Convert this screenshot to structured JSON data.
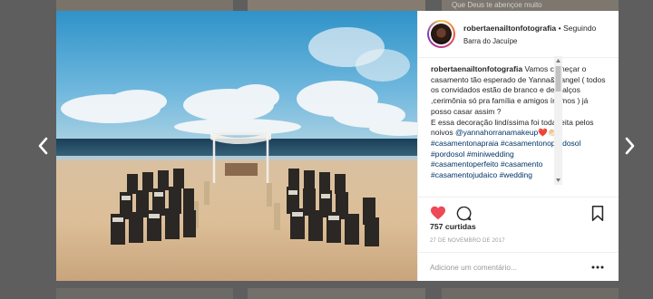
{
  "background": {
    "caption_text": "Que Deus te abençoe muito"
  },
  "post": {
    "username": "robertaenailtonfotografia",
    "separator": "•",
    "follow_status": "Seguindo",
    "location": "Barra do Jacuípe",
    "caption": {
      "user": "robertaenailtonfotografia",
      "text_1": "Vamos começar o casamento tão esperado de Yanna&Rangel ( todos os convidados estão de branco e descalços ,cerimônia só pra família e amigos íntimos ) já posso casar assim ?",
      "text_2": "E essa decoração lindíssima foi toda feita pelos noivos",
      "mention": "@yannahorranamakeup",
      "emoji": "❤️👏🏻",
      "hashtags": [
        "#casamentonapraia",
        "#casamentonopordosol",
        "#pordosol",
        "#miniwedding",
        "#casamentoperfeito",
        "#casamento",
        "#casamentojudaico",
        "#wedding"
      ]
    },
    "likes": "757 curtidas",
    "date": "27 DE NOVEMBRO DE 2017",
    "comment_placeholder": "Adicione um comentário...",
    "more_label": "•••"
  },
  "colors": {
    "like_red": "#ed4956",
    "link_blue": "#003569",
    "muted_gray": "#999999"
  },
  "icons": {
    "prev": "chevron-left-icon",
    "next": "chevron-right-icon",
    "like": "heart-icon",
    "comment": "comment-icon",
    "save": "bookmark-icon",
    "more": "ellipsis-icon"
  }
}
